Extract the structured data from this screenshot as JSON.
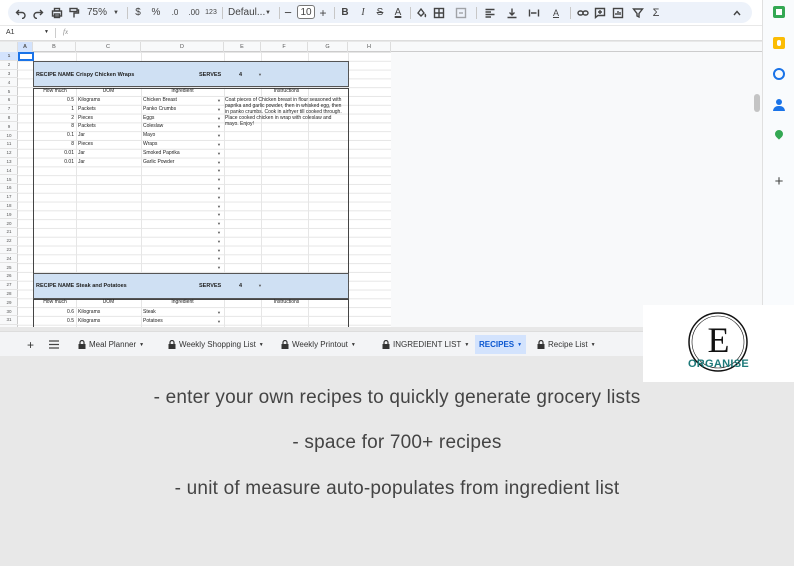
{
  "toolbar": {
    "zoom": "75%",
    "currency": "$",
    "percent": "%",
    "decrease_decimal": ".0",
    "increase_decimal": ".00",
    "number_format": "123",
    "font": "Defaul...",
    "font_size": "10",
    "bold": "B",
    "italic": "I",
    "text_color_glyph": "A",
    "sum": "Σ"
  },
  "formula_bar": {
    "cell_ref": "A1",
    "fx": "fx"
  },
  "columns": [
    "A",
    "B",
    "C",
    "D",
    "E",
    "F",
    "G",
    "H"
  ],
  "rows": [
    "1",
    "2",
    "3",
    "4",
    "5",
    "6",
    "7",
    "8",
    "9",
    "10",
    "11",
    "12",
    "13",
    "14",
    "15",
    "16",
    "17",
    "18",
    "19",
    "20",
    "21",
    "22",
    "23",
    "24",
    "25",
    "26",
    "27",
    "28",
    "29",
    "30",
    "31"
  ],
  "recipe1": {
    "name_label": "RECIPE NAME",
    "name": "Crispy Chicken Wraps",
    "serves_label": "SERVES",
    "serves": "4",
    "headers": {
      "how_much": "How much",
      "uom": "UOM",
      "ingredient": "Ingredient",
      "instructions": "Instructions"
    },
    "instructions": "Coat pieces of Chicken breast in flour seasoned with paprika and garlic powder, then in whisked egg, then in panko crumbs. Cook in airfryer till cooked through. Place cooked chicken in wrap with coleslaw and mayo. Enjoy!",
    "items": [
      {
        "qty": "0.5",
        "uom": "Kilograms",
        "ingredient": "Chicken Breast"
      },
      {
        "qty": "1",
        "uom": "Packets",
        "ingredient": "Panko Crumbs"
      },
      {
        "qty": "2",
        "uom": "Pieces",
        "ingredient": "Eggs"
      },
      {
        "qty": "8",
        "uom": "Packets",
        "ingredient": "Coleslaw"
      },
      {
        "qty": "0.1",
        "uom": "Jar",
        "ingredient": "Mayo"
      },
      {
        "qty": "8",
        "uom": "Pieces",
        "ingredient": "Wraps"
      },
      {
        "qty": "0.01",
        "uom": "Jar",
        "ingredient": "Smoked Paprika"
      },
      {
        "qty": "0.01",
        "uom": "Jar",
        "ingredient": "Garlic Powder"
      }
    ]
  },
  "recipe2": {
    "name_label": "RECIPE NAME",
    "name": "Steak and Potatoes",
    "serves_label": "SERVES",
    "serves": "4",
    "headers": {
      "how_much": "How much",
      "uom": "UOM",
      "ingredient": "Ingredient",
      "instructions": "Instructions"
    },
    "items": [
      {
        "qty": "0.6",
        "uom": "Kilograms",
        "ingredient": "Steak"
      },
      {
        "qty": "0.5",
        "uom": "Kilograms",
        "ingredient": "Potatoes"
      }
    ]
  },
  "tabs": [
    {
      "label": "Meal Planner",
      "locked": true
    },
    {
      "label": "Weekly Shopping List",
      "locked": true
    },
    {
      "label": "Weekly Printout",
      "locked": true
    },
    {
      "label": "INGREDIENT LIST",
      "locked": true
    },
    {
      "label": "RECIPES",
      "locked": false,
      "active": true
    },
    {
      "label": "Recipe List",
      "locked": true
    }
  ],
  "logo": {
    "letter": "E",
    "word": "ORGANISE"
  },
  "captions": [
    "- enter your own recipes to quickly generate grocery lists",
    "- space for 700+ recipes",
    "- unit of measure auto-populates from ingredient list"
  ],
  "colors": {
    "header_band": "#cfe0f3",
    "active_tab": "#d3e3fd",
    "logo_text": "#1e7a7a",
    "background": "#e8e8e8"
  }
}
